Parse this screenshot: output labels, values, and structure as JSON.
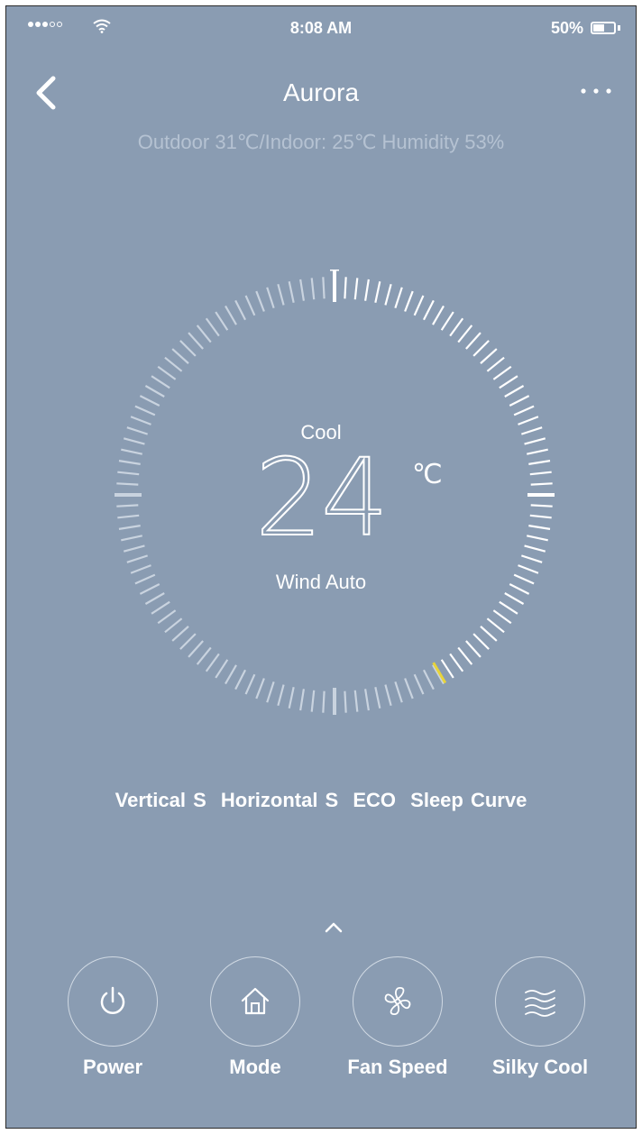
{
  "status": {
    "time": "8:08 AM",
    "battery": "50%"
  },
  "nav": {
    "title": "Aurora",
    "back_icon": "chevron-left-icon",
    "more_icon": "more-horizontal-icon"
  },
  "subtitle": "Outdoor 31℃/Indoor: 25℃ Humidity 53%",
  "dial": {
    "mode": "Cool",
    "temperature": "24",
    "unit": "℃",
    "wind": "Wind Auto",
    "setpoint_fraction": 0.5,
    "accent_color": "#e8d43a",
    "active_color": "#ffffff",
    "inactive_color": "#c9d3df"
  },
  "features": [
    "Vertical S",
    "Horizontal S",
    "ECO",
    "Sleep Curve"
  ],
  "controls": [
    {
      "label": "Power",
      "icon": "power-icon"
    },
    {
      "label": "Mode",
      "icon": "home-icon"
    },
    {
      "label": "Fan Speed",
      "icon": "fan-icon"
    },
    {
      "label": "Silky Cool",
      "icon": "wind-waves-icon"
    }
  ]
}
